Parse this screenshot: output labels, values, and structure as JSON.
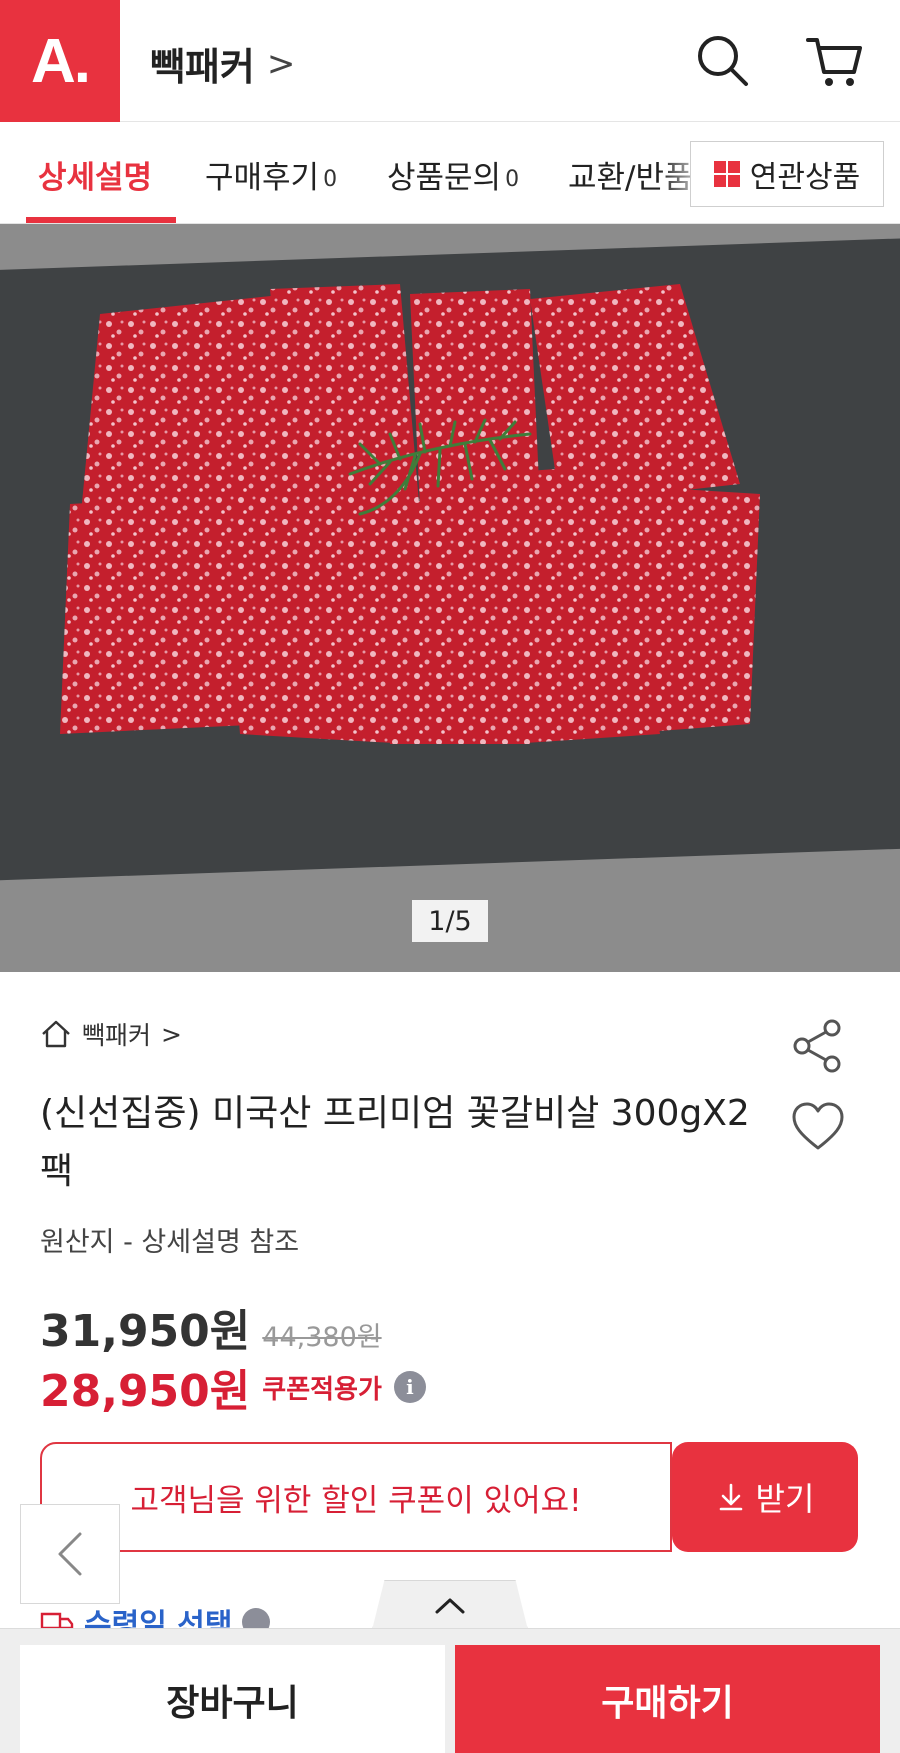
{
  "header": {
    "logo_text": "A.",
    "store_name": "빽패커",
    "chevron": ">",
    "brand_color": "#e8323f"
  },
  "tabs": [
    {
      "label": "상세설명",
      "count": ""
    },
    {
      "label": "구매후기",
      "count": "0"
    },
    {
      "label": "상품문의",
      "count": "0"
    },
    {
      "label": "교환/반품",
      "count": ""
    }
  ],
  "related_button": {
    "label": "연관상품"
  },
  "hero": {
    "pager": "1/5"
  },
  "product": {
    "breadcrumb": "빽패커",
    "breadcrumb_chevron": ">",
    "title": "(신선집중) 미국산 프리미엄 꽃갈비살 300gX2팩",
    "origin": "원산지 - 상세설명 참조",
    "price": "31,950원",
    "original_price": "44,380원",
    "coupon_price": "28,950원",
    "coupon_label": "쿠폰적용가",
    "info_glyph": "i"
  },
  "coupon_banner": {
    "message": "고객님을 위한 할인 쿠폰이 있어요!",
    "button_label": "받기"
  },
  "partial_row": {
    "label": "수령일 선택"
  },
  "bottom_bar": {
    "cart_label": "장바구니",
    "buy_label": "구매하기"
  },
  "colors": {
    "accent": "#e8323f",
    "coupon_text": "#d71f35",
    "link_blue": "#2a63c9"
  }
}
